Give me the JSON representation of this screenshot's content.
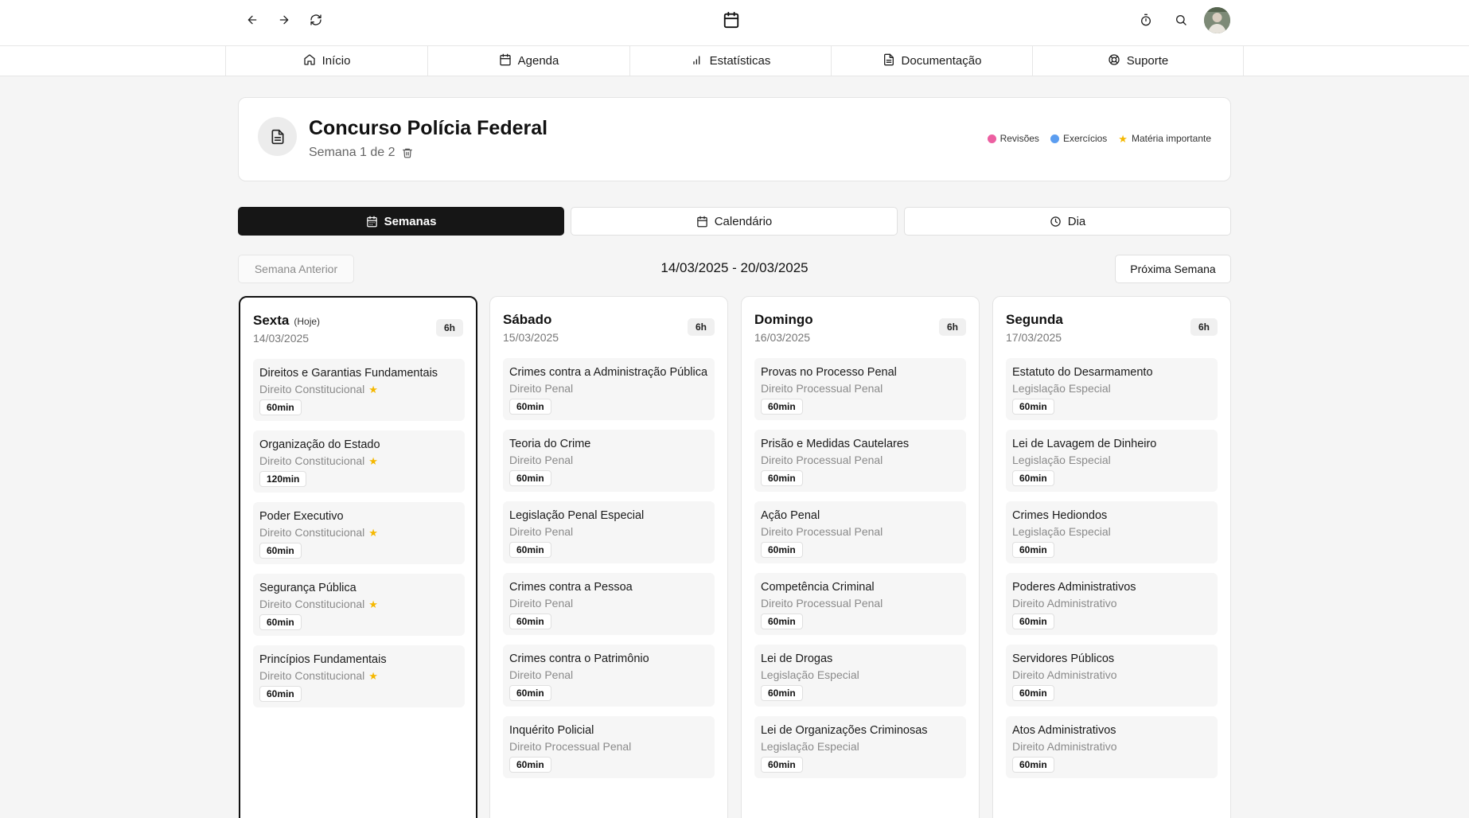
{
  "topbar": {
    "back_icon": "arrow-left-icon",
    "forward_icon": "arrow-right-icon",
    "reload_icon": "refresh-icon",
    "app_icon": "calendar-icon",
    "timer_icon": "stopwatch-icon",
    "search_icon": "search-icon"
  },
  "nav": [
    {
      "label": "Início",
      "icon": "home-icon"
    },
    {
      "label": "Agenda",
      "icon": "calendar-icon"
    },
    {
      "label": "Estatísticas",
      "icon": "bar-chart-icon"
    },
    {
      "label": "Documentação",
      "icon": "document-icon"
    },
    {
      "label": "Suporte",
      "icon": "lifebuoy-icon"
    }
  ],
  "header": {
    "title": "Concurso Polícia Federal",
    "subtitle": "Semana 1 de 2",
    "legend": [
      {
        "label": "Revisões",
        "color": "#ec5fa1"
      },
      {
        "label": "Exercícios",
        "color": "#5b9df0"
      },
      {
        "label": "Matéria importante",
        "color": "#f5b800"
      }
    ]
  },
  "view_tabs": [
    {
      "label": "Semanas",
      "active": true
    },
    {
      "label": "Calendário",
      "active": false
    },
    {
      "label": "Dia",
      "active": false
    }
  ],
  "week": {
    "prev_label": "Semana Anterior",
    "next_label": "Próxima Semana",
    "range": "14/03/2025 - 20/03/2025"
  },
  "days": [
    {
      "name": "Sexta",
      "today_label": "(Hoje)",
      "date": "14/03/2025",
      "hours": "6h",
      "items": [
        {
          "title": "Direitos e Garantias Fundamentais",
          "subject": "Direito Constitucional",
          "important": true,
          "duration": "60min"
        },
        {
          "title": "Organização do Estado",
          "subject": "Direito Constitucional",
          "important": true,
          "duration": "120min"
        },
        {
          "title": "Poder Executivo",
          "subject": "Direito Constitucional",
          "important": true,
          "duration": "60min"
        },
        {
          "title": "Segurança Pública",
          "subject": "Direito Constitucional",
          "important": true,
          "duration": "60min"
        },
        {
          "title": "Princípios Fundamentais",
          "subject": "Direito Constitucional",
          "important": true,
          "duration": "60min"
        }
      ]
    },
    {
      "name": "Sábado",
      "today_label": "",
      "date": "15/03/2025",
      "hours": "6h",
      "items": [
        {
          "title": "Crimes contra a Administração Pública",
          "subject": "Direito Penal",
          "important": false,
          "duration": "60min"
        },
        {
          "title": "Teoria do Crime",
          "subject": "Direito Penal",
          "important": false,
          "duration": "60min"
        },
        {
          "title": "Legislação Penal Especial",
          "subject": "Direito Penal",
          "important": false,
          "duration": "60min"
        },
        {
          "title": "Crimes contra a Pessoa",
          "subject": "Direito Penal",
          "important": false,
          "duration": "60min"
        },
        {
          "title": "Crimes contra o Patrimônio",
          "subject": "Direito Penal",
          "important": false,
          "duration": "60min"
        },
        {
          "title": "Inquérito Policial",
          "subject": "Direito Processual Penal",
          "important": false,
          "duration": "60min"
        }
      ]
    },
    {
      "name": "Domingo",
      "today_label": "",
      "date": "16/03/2025",
      "hours": "6h",
      "items": [
        {
          "title": "Provas no Processo Penal",
          "subject": "Direito Processual Penal",
          "important": false,
          "duration": "60min"
        },
        {
          "title": "Prisão e Medidas Cautelares",
          "subject": "Direito Processual Penal",
          "important": false,
          "duration": "60min"
        },
        {
          "title": "Ação Penal",
          "subject": "Direito Processual Penal",
          "important": false,
          "duration": "60min"
        },
        {
          "title": "Competência Criminal",
          "subject": "Direito Processual Penal",
          "important": false,
          "duration": "60min"
        },
        {
          "title": "Lei de Drogas",
          "subject": "Legislação Especial",
          "important": false,
          "duration": "60min"
        },
        {
          "title": "Lei de Organizações Criminosas",
          "subject": "Legislação Especial",
          "important": false,
          "duration": "60min"
        }
      ]
    },
    {
      "name": "Segunda",
      "today_label": "",
      "date": "17/03/2025",
      "hours": "6h",
      "items": [
        {
          "title": "Estatuto do Desarmamento",
          "subject": "Legislação Especial",
          "important": false,
          "duration": "60min"
        },
        {
          "title": "Lei de Lavagem de Dinheiro",
          "subject": "Legislação Especial",
          "important": false,
          "duration": "60min"
        },
        {
          "title": "Crimes Hediondos",
          "subject": "Legislação Especial",
          "important": false,
          "duration": "60min"
        },
        {
          "title": "Poderes Administrativos",
          "subject": "Direito Administrativo",
          "important": false,
          "duration": "60min"
        },
        {
          "title": "Servidores Públicos",
          "subject": "Direito Administrativo",
          "important": false,
          "duration": "60min"
        },
        {
          "title": "Atos Administrativos",
          "subject": "Direito Administrativo",
          "important": false,
          "duration": "60min"
        }
      ]
    }
  ]
}
